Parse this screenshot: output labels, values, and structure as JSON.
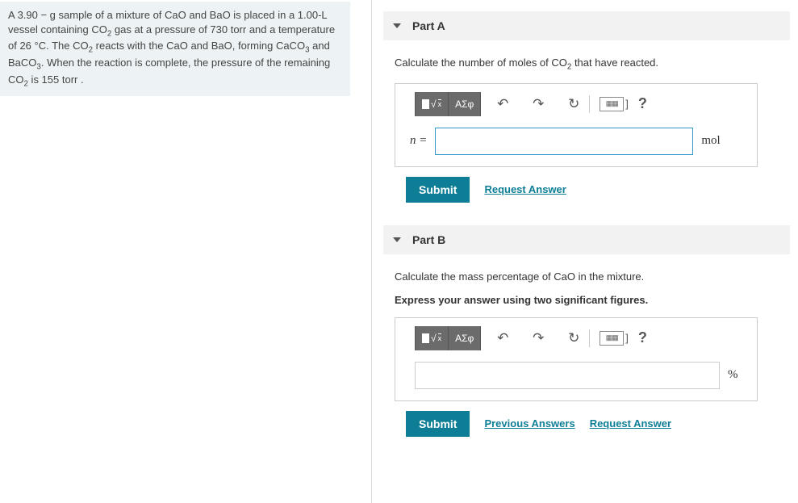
{
  "problem": {
    "text_html": "A 3.90 − g sample of a mixture of CaO and BaO is placed in a 1.00-L vessel containing CO<sub>2</sub> gas at a pressure of 730 torr and a temperature of 26 °C. The CO<sub>2</sub> reacts with the CaO and BaO, forming CaCO<sub>3</sub> and BaCO<sub>3</sub>. When the reaction is complete, the pressure of the remaining CO<sub>2</sub> is 155 torr ."
  },
  "partA": {
    "header": "Part A",
    "instruction_html": "Calculate the number of moles of CO<sub>2</sub> that have reacted.",
    "var_label": "n =",
    "unit": "mol",
    "submit": "Submit",
    "request_answer": "Request Answer"
  },
  "partB": {
    "header": "Part B",
    "instruction_html": "Calculate the mass percentage of CaO in the mixture.",
    "directive": "Express your answer using two significant figures.",
    "unit": "%",
    "submit": "Submit",
    "previous_answers": "Previous Answers",
    "request_answer": "Request Answer"
  },
  "toolbar": {
    "templates": "▮√x",
    "greek": "ΑΣφ",
    "undo": "↶",
    "redo": "↷",
    "reset": "↻",
    "keyboard": "⌨",
    "help": "?"
  }
}
